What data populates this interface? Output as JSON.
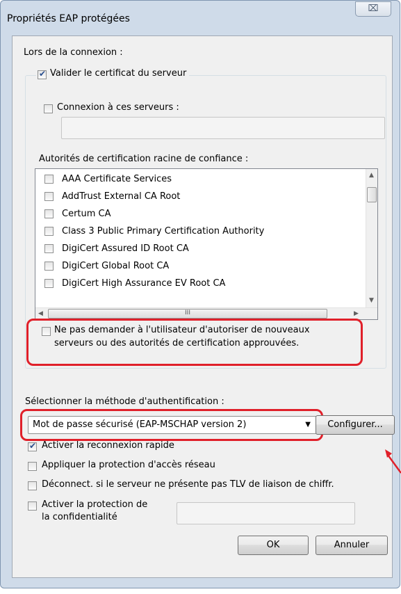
{
  "window": {
    "title": "Propriétés EAP protégées",
    "close_label": "⌧"
  },
  "connection": {
    "heading": "Lors de la connexion :",
    "validate_certificate": {
      "label": "Valider le certificat du serveur",
      "checked": true
    },
    "connect_to_servers": {
      "label": "Connexion à ces serveurs :",
      "checked": false,
      "value": ""
    },
    "trusted_roots_label": "Autorités de certification racine de confiance :",
    "ca_list": [
      {
        "label": "AAA Certificate Services",
        "checked": false
      },
      {
        "label": "AddTrust External CA Root",
        "checked": false
      },
      {
        "label": "Certum CA",
        "checked": false
      },
      {
        "label": "Class 3 Public Primary Certification Authority",
        "checked": false
      },
      {
        "label": "DigiCert Assured ID Root CA",
        "checked": false
      },
      {
        "label": "DigiCert Global Root CA",
        "checked": false
      },
      {
        "label": "DigiCert High Assurance EV Root CA",
        "checked": false
      }
    ],
    "hscroll_grip": "III",
    "no_prompt": {
      "line1": "Ne pas demander à l'utilisateur d'autoriser de nouveaux",
      "line2": "serveurs ou des autorités de certification approuvées.",
      "checked": false
    }
  },
  "auth": {
    "heading": "Sélectionner la méthode d'authentification :",
    "method_value": "Mot de passe sécurisé (EAP-MSCHAP version 2)",
    "configure_label": "Configurer..."
  },
  "options": {
    "fast_reconnect": {
      "label": "Activer la reconnexion rapide",
      "checked": true
    },
    "nap": {
      "label": "Appliquer la protection d'accès réseau",
      "checked": false
    },
    "disconnect_tlv": {
      "label": "Déconnect. si le serveur ne présente pas TLV de liaison de chiffr.",
      "checked": false
    },
    "privacy": {
      "line1": "Activer la protection de",
      "line2": "la confidentialité",
      "checked": false,
      "value": ""
    }
  },
  "buttons": {
    "ok": "OK",
    "cancel": "Annuler"
  },
  "colors": {
    "highlight": "#e0202a",
    "accent_check": "#2a4f8f"
  }
}
